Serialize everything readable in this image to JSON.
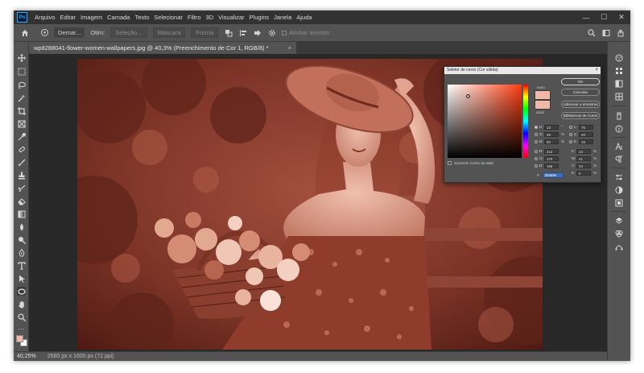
{
  "app": {
    "logo_text": "Ps"
  },
  "menu": [
    "Arquivo",
    "Editar",
    "Imagem",
    "Camada",
    "Texto",
    "Selecionar",
    "Filtro",
    "3D",
    "Visualizar",
    "Plugins",
    "Janela",
    "Ajuda"
  ],
  "window_controls": {
    "minimize": "—",
    "maximize": "☐",
    "close": "✕"
  },
  "options_bar": {
    "style_select": "Demar...",
    "label_otim": "Otim:",
    "btn_selecao": "Seleção...",
    "btn_mascara": "Máscara",
    "btn_forma": "Forma",
    "align_edges": "Alinhar arestas"
  },
  "document_tab": {
    "title": "wp8288041-flower-women-wallpapers.jpg @ 40,3% (Preenchimento de Cor 1, RGB/8) *",
    "close": "×"
  },
  "status": {
    "zoom": "40,25%",
    "dimensions": "2560 px x 1600 px (72 ppi)"
  },
  "color_picker": {
    "title": "Seletor de cores (Cor sólida)",
    "close": "×",
    "label_new": "novo",
    "label_current": "atual",
    "btn_ok": "OK",
    "btn_cancel": "Cancelar",
    "btn_add_swatches": "Adicionar a amostras",
    "btn_libraries": "Bibliotecas de Cores",
    "web_only": "Somente Cores da Web",
    "hsb": [
      {
        "label": "H:",
        "value": "13",
        "unit": "°"
      },
      {
        "label": "S:",
        "value": "25",
        "unit": "%"
      },
      {
        "label": "B:",
        "value": "83",
        "unit": "%"
      }
    ],
    "rgb": [
      {
        "label": "R:",
        "value": "212",
        "unit": ""
      },
      {
        "label": "G:",
        "value": "170",
        "unit": ""
      },
      {
        "label": "B:",
        "value": "158",
        "unit": ""
      }
    ],
    "lab": [
      {
        "label": "L:",
        "value": "75",
        "unit": ""
      },
      {
        "label": "a:",
        "value": "20",
        "unit": ""
      },
      {
        "label": "b:",
        "value": "15",
        "unit": ""
      }
    ],
    "cmyk": [
      {
        "label": "C:",
        "value": "13",
        "unit": "%"
      },
      {
        "label": "M:",
        "value": "41",
        "unit": "%"
      },
      {
        "label": "Y:",
        "value": "34",
        "unit": "%"
      },
      {
        "label": "K:",
        "value": "0",
        "unit": "%"
      }
    ],
    "hex": "d4aa9e",
    "swatch_color": "#f0b8a8"
  },
  "colors": {
    "workspace": "#535353",
    "canvas_bg": "#282828",
    "menubar": "#323232",
    "tint": "#b85a48"
  }
}
